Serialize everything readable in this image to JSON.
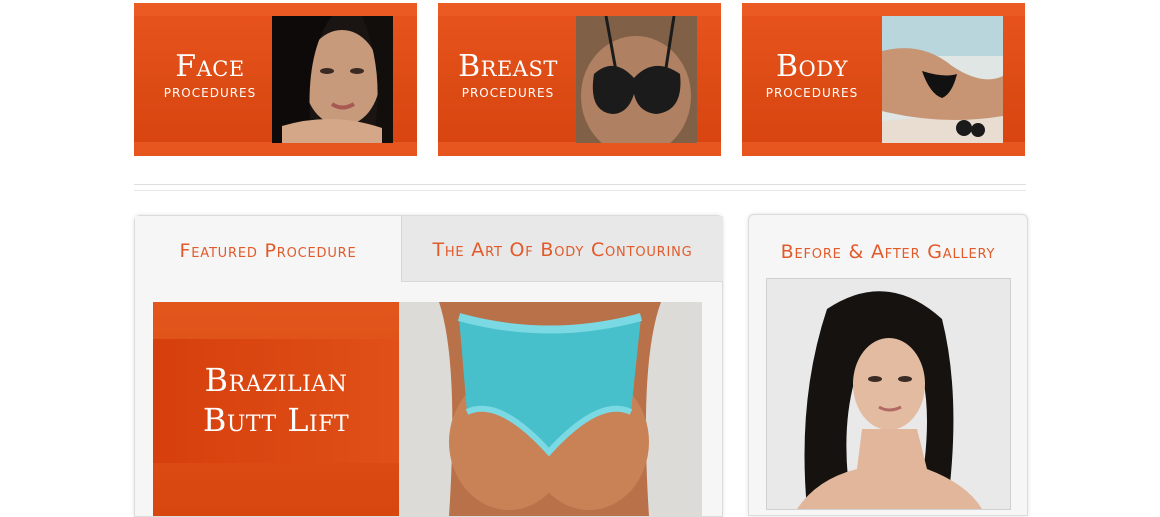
{
  "tiles": [
    {
      "title": "Face",
      "subtitle": "Procedures"
    },
    {
      "title": "Breast",
      "subtitle": "Procedures"
    },
    {
      "title": "Body",
      "subtitle": "Procedures"
    }
  ],
  "featured": {
    "tabs": [
      {
        "label": "Featured Procedure"
      },
      {
        "label": "The Art Of Body Contouring"
      }
    ],
    "procedure_line1": "Brazilian",
    "procedure_line2": "Butt Lift"
  },
  "gallery": {
    "title": "Before & After Gallery"
  },
  "colors": {
    "accent": "#e25a2a",
    "tile_orange": "#dd4b15",
    "panel_bg": "#f6f6f6"
  }
}
